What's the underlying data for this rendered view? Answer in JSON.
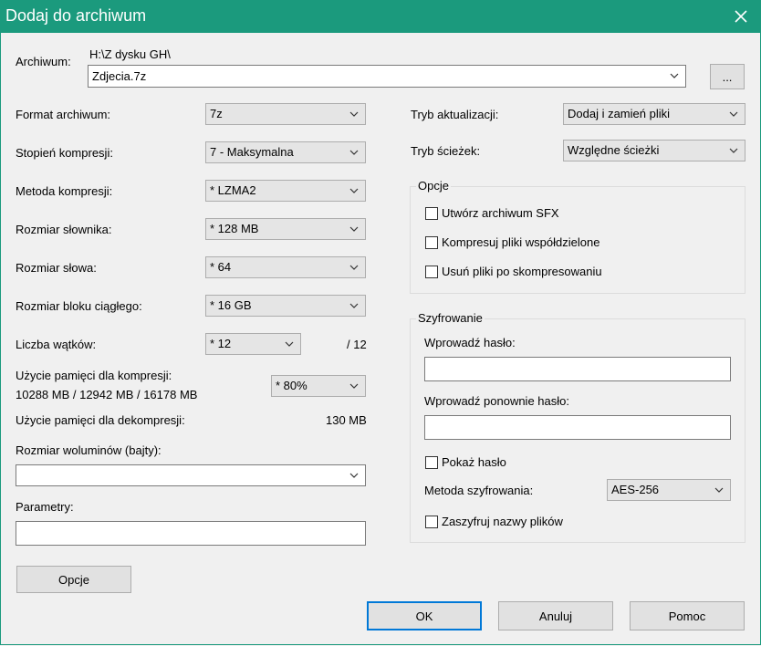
{
  "window": {
    "title": "Dodaj do archiwum"
  },
  "archive": {
    "label": "Archiwum:",
    "path": "H:\\Z dysku GH\\",
    "name": "Zdjecia.7z",
    "browse_label": "..."
  },
  "left": {
    "format": {
      "label": "Format archiwum:",
      "value": "7z"
    },
    "level": {
      "label": "Stopień kompresji:",
      "value": "7 - Maksymalna"
    },
    "method": {
      "label": "Metoda kompresji:",
      "value": "*  LZMA2"
    },
    "dict": {
      "label": "Rozmiar słownika:",
      "value": "*  128 MB"
    },
    "word": {
      "label": "Rozmiar słowa:",
      "value": "*  64"
    },
    "block": {
      "label": "Rozmiar bloku ciągłego:",
      "value": "*  16 GB"
    },
    "threads": {
      "label": "Liczba wątków:",
      "value": "*  12",
      "max": "/ 12"
    },
    "mem_comp": {
      "label": "Użycie pamięci dla kompresji:",
      "detail": "10288 MB / 12942 MB / 16178 MB",
      "value": "*  80%"
    },
    "mem_decomp": {
      "label": "Użycie pamięci dla dekompresji:",
      "value": "130 MB"
    },
    "volumes": {
      "label": "Rozmiar woluminów (bajty):",
      "value": ""
    },
    "params": {
      "label": "Parametry:",
      "value": ""
    },
    "options_button": "Opcje"
  },
  "right": {
    "update_mode": {
      "label": "Tryb aktualizacji:",
      "value": "Dodaj i zamień pliki"
    },
    "path_mode": {
      "label": "Tryb ścieżek:",
      "value": "Względne ścieżki"
    },
    "options_group": {
      "title": "Opcje",
      "sfx": "Utwórz archiwum SFX",
      "shared": "Kompresuj pliki współdzielone",
      "delete": "Usuń pliki po skompresowaniu"
    },
    "encryption": {
      "title": "Szyfrowanie",
      "password_label": "Wprowadź hasło:",
      "password_value": "",
      "repeat_label": "Wprowadź ponownie hasło:",
      "repeat_value": "",
      "show_password": "Pokaż hasło",
      "method_label": "Metoda szyfrowania:",
      "method_value": "AES-256",
      "encrypt_names": "Zaszyfruj nazwy plików"
    }
  },
  "buttons": {
    "ok": "OK",
    "cancel": "Anuluj",
    "help": "Pomoc"
  },
  "colors": {
    "titlebar": "#1b9a7d",
    "default_button_border": "#0078d7"
  }
}
